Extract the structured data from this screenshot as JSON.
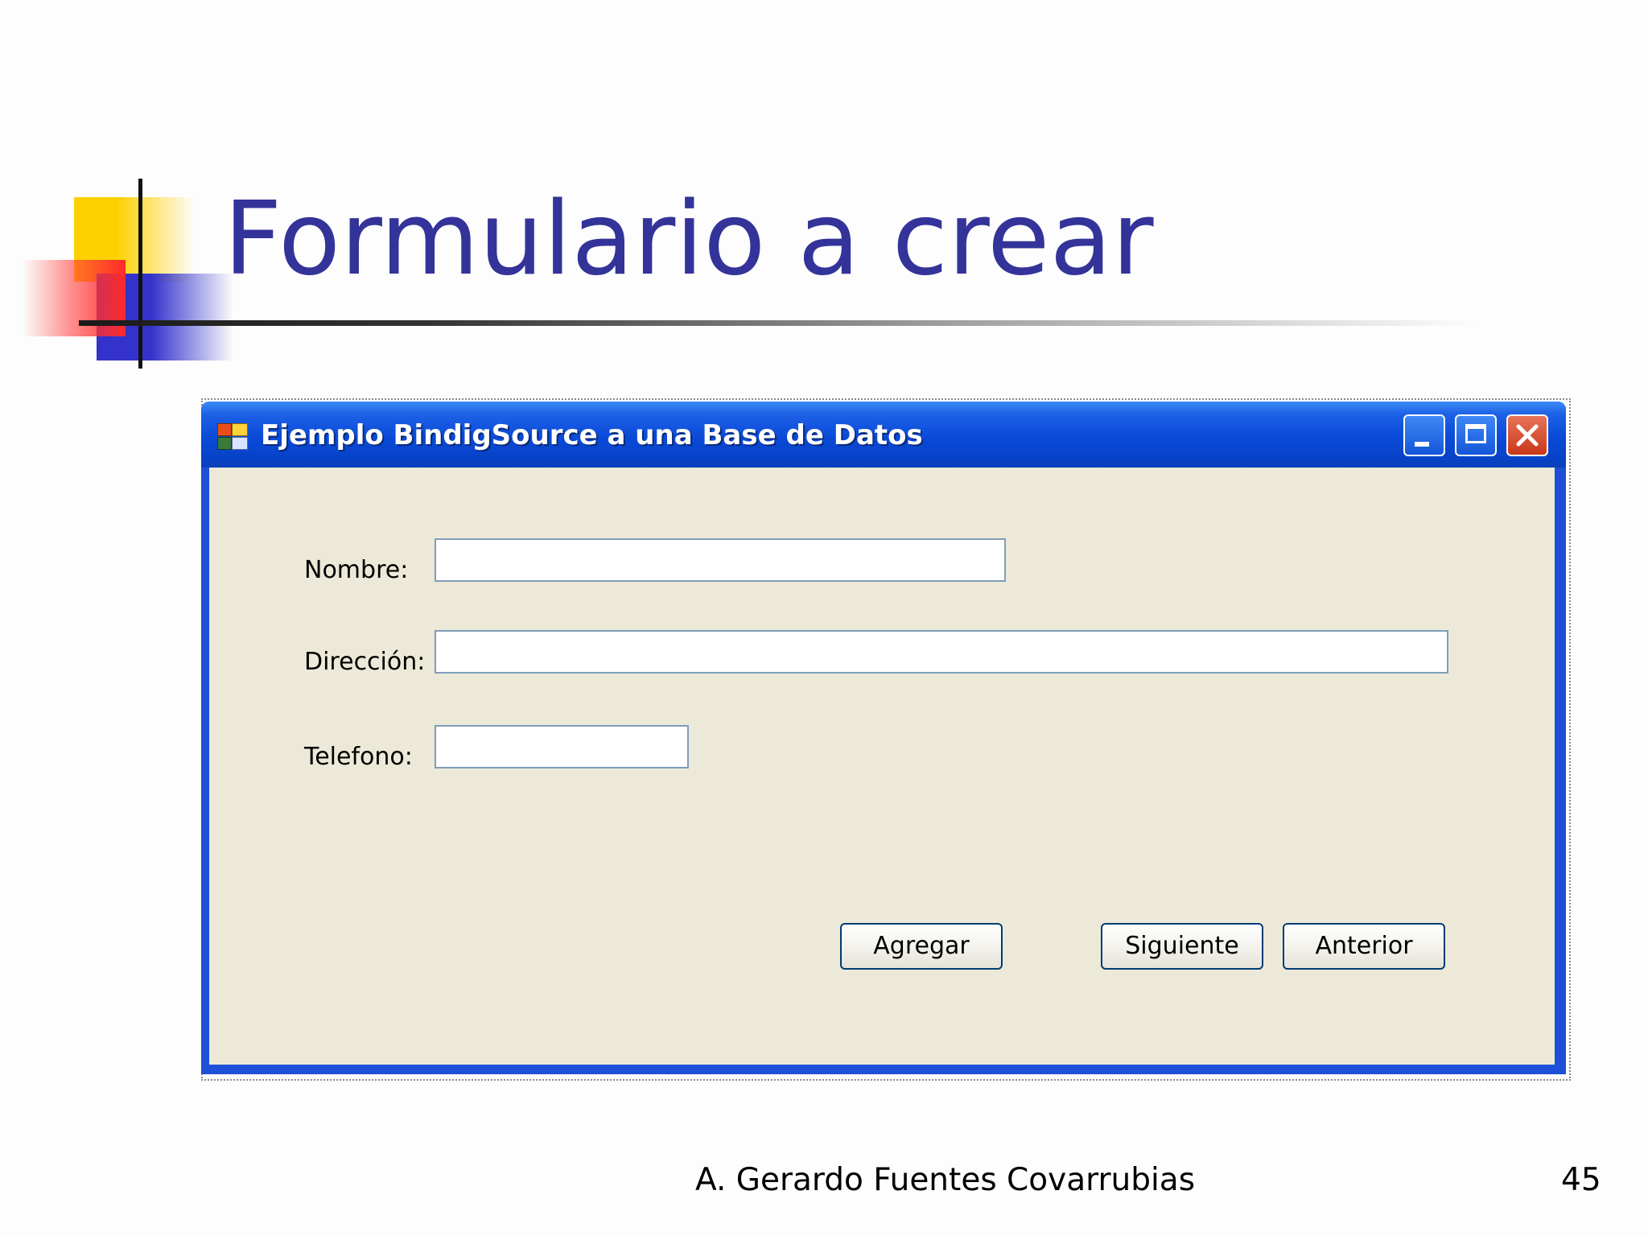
{
  "slide": {
    "title": "Formulario a crear",
    "footer_author": "A. Gerardo Fuentes Covarrubias",
    "page_number": "45"
  },
  "window": {
    "title": "Ejemplo BindigSource a una Base de Datos",
    "controls": [
      "minimize-icon",
      "maximize-icon",
      "close-icon"
    ]
  },
  "form": {
    "fields": [
      {
        "label": "Nombre:",
        "value": ""
      },
      {
        "label": "Dirección:",
        "value": ""
      },
      {
        "label": "Telefono:",
        "value": ""
      }
    ],
    "buttons": {
      "add": "Agregar",
      "next": "Siguiente",
      "previous": "Anterior"
    }
  },
  "colors": {
    "title_text": "#333399",
    "titlebar": "#0a4ad8",
    "client_background": "#ece9d8",
    "close_button": "#c83818"
  }
}
